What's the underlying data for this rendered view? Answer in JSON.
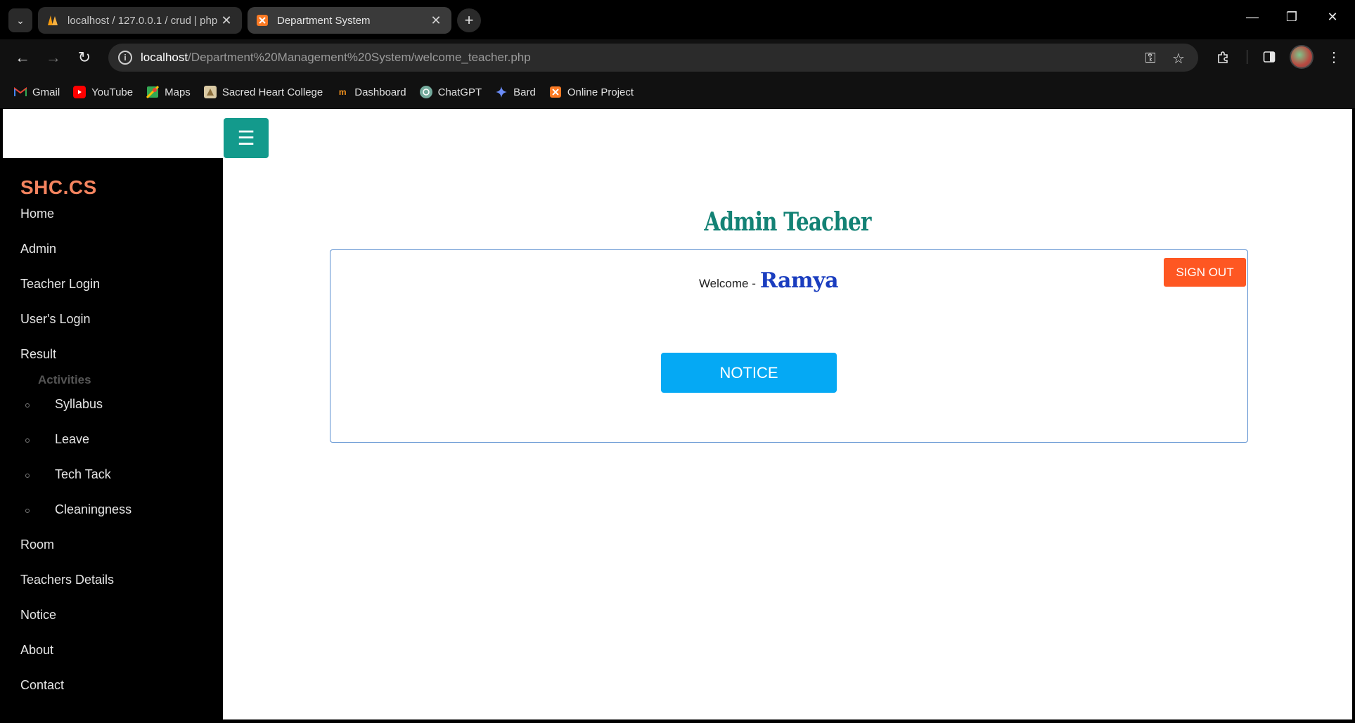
{
  "browser": {
    "tabs": [
      {
        "title": "localhost / 127.0.0.1 / crud | php",
        "active": false
      },
      {
        "title": "Department System",
        "active": true
      }
    ],
    "url_host": "localhost",
    "url_path": "/Department%20Management%20System/welcome_teacher.php",
    "bookmarks": [
      {
        "label": "Gmail",
        "icon": "gmail-icon"
      },
      {
        "label": "YouTube",
        "icon": "youtube-icon"
      },
      {
        "label": "Maps",
        "icon": "maps-icon"
      },
      {
        "label": "Sacred Heart College",
        "icon": "college-icon"
      },
      {
        "label": "Dashboard",
        "icon": "dashboard-icon"
      },
      {
        "label": "ChatGPT",
        "icon": "chatgpt-icon"
      },
      {
        "label": "Bard",
        "icon": "bard-icon"
      },
      {
        "label": "Online Project",
        "icon": "xampp-icon"
      }
    ]
  },
  "sidebar": {
    "brand": "SHC.CS",
    "items": [
      "Home",
      "Admin",
      "Teacher Login",
      "User's Login",
      "Result"
    ],
    "activities_heading": "Activities",
    "sub_items": [
      "Syllabus",
      "Leave",
      "Tech Tack",
      "Cleaningness"
    ],
    "items_after": [
      "Room",
      "Teachers Details",
      "Notice",
      "About",
      "Contact"
    ]
  },
  "main": {
    "heading": "Admin Teacher",
    "welcome_label": "Welcome -",
    "user_name": "Ramya",
    "signout_label": "SIGN OUT",
    "notice_label": "NOTICE"
  },
  "colors": {
    "sidebar_bg": "#000000",
    "brand": "#f4845f",
    "heading": "#138275",
    "toggle": "#139a8c",
    "signout": "#fe5722",
    "notice": "#05a9f4",
    "user_name": "#1a3dbf"
  }
}
